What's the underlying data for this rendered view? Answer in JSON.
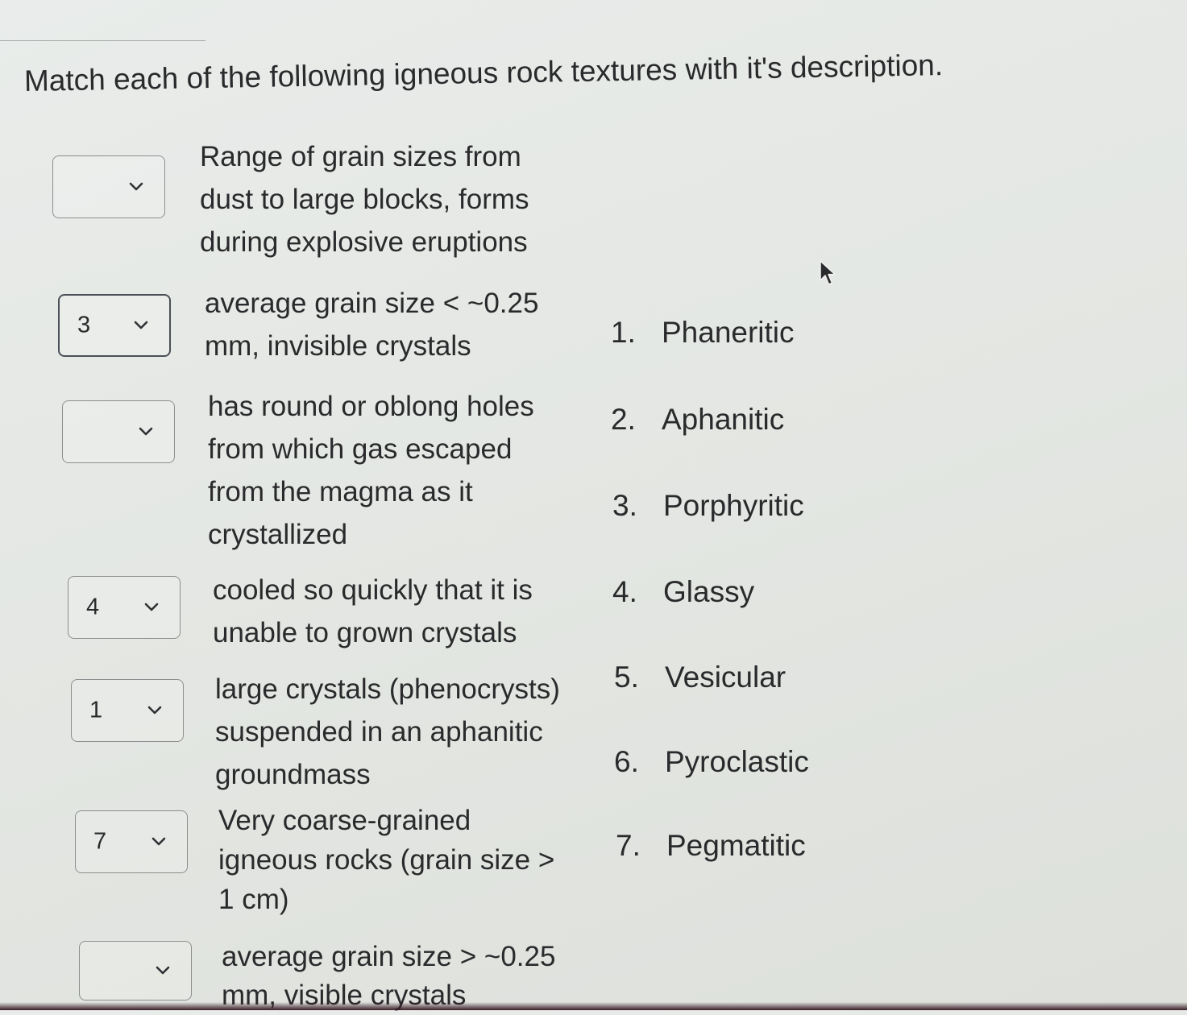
{
  "question": {
    "prompt": "Match each of the following igneous rock textures with it's description."
  },
  "matches": [
    {
      "selected": "",
      "description": "Range of grain sizes from dust to large blocks, forms during explosive eruptions"
    },
    {
      "selected": "3",
      "description": "average grain size < ~0.25 mm, invisible crystals"
    },
    {
      "selected": "",
      "description": "has round or oblong holes from which gas escaped from the magma as it crystallized"
    },
    {
      "selected": "4",
      "description": "cooled so quickly that it is unable to grown crystals"
    },
    {
      "selected": "1",
      "description": "large crystals (phenocrysts) suspended in an aphanitic groundmass"
    },
    {
      "selected": "7",
      "description": "Very coarse-grained igneous rocks (grain size > 1 cm)"
    },
    {
      "selected": "",
      "description": "average grain size > ~0.25 mm, visible crystals"
    }
  ],
  "options": [
    {
      "number": "1.",
      "label": "Phaneritic"
    },
    {
      "number": "2.",
      "label": "Aphanitic"
    },
    {
      "number": "3.",
      "label": "Porphyritic"
    },
    {
      "number": "4.",
      "label": "Glassy"
    },
    {
      "number": "5.",
      "label": "Vesicular"
    },
    {
      "number": "6.",
      "label": "Pyroclastic"
    },
    {
      "number": "7.",
      "label": "Pegmatitic"
    }
  ],
  "icons": {
    "dropdown": "chevron-down-icon",
    "cursor": "mouse-pointer-icon"
  }
}
